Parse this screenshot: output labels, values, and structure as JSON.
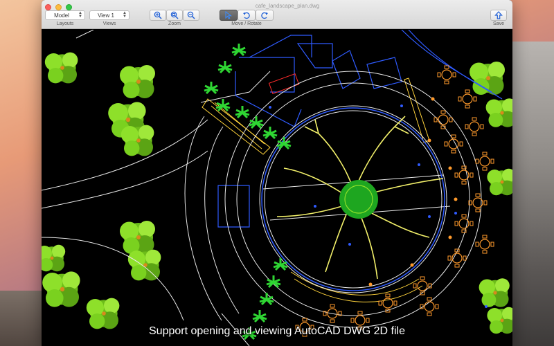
{
  "window": {
    "title": "cafe_landscape_plan.dwg"
  },
  "toolbar": {
    "layouts": {
      "value": "Model",
      "label": "Layouts"
    },
    "views": {
      "value": "View 1",
      "label": "Views"
    },
    "zoom": {
      "label": "Zoom"
    },
    "move_rotate": {
      "label": "Move / Rotate"
    },
    "save": {
      "label": "Save"
    }
  },
  "icons": {
    "zoom_in": "zoom-in-icon",
    "zoom_fit": "zoom-fit-icon",
    "zoom_out": "zoom-out-icon",
    "select": "cursor-icon",
    "rotate_left": "rotate-left-icon",
    "rotate_right": "rotate-right-icon",
    "save": "save-icon"
  },
  "colors": {
    "canvas": "#000000",
    "accent_active": "#5d5d5d",
    "cad_white": "#ffffff",
    "cad_blue": "#2f5bff",
    "cad_yellow": "#ffd33b",
    "cad_red": "#ff2b2b",
    "cad_green": "#2fd633",
    "cad_orange": "#ff9a2b",
    "tree_green": "#7ad11f"
  },
  "caption": "Support opening and viewing AutoCAD DWG 2D file"
}
